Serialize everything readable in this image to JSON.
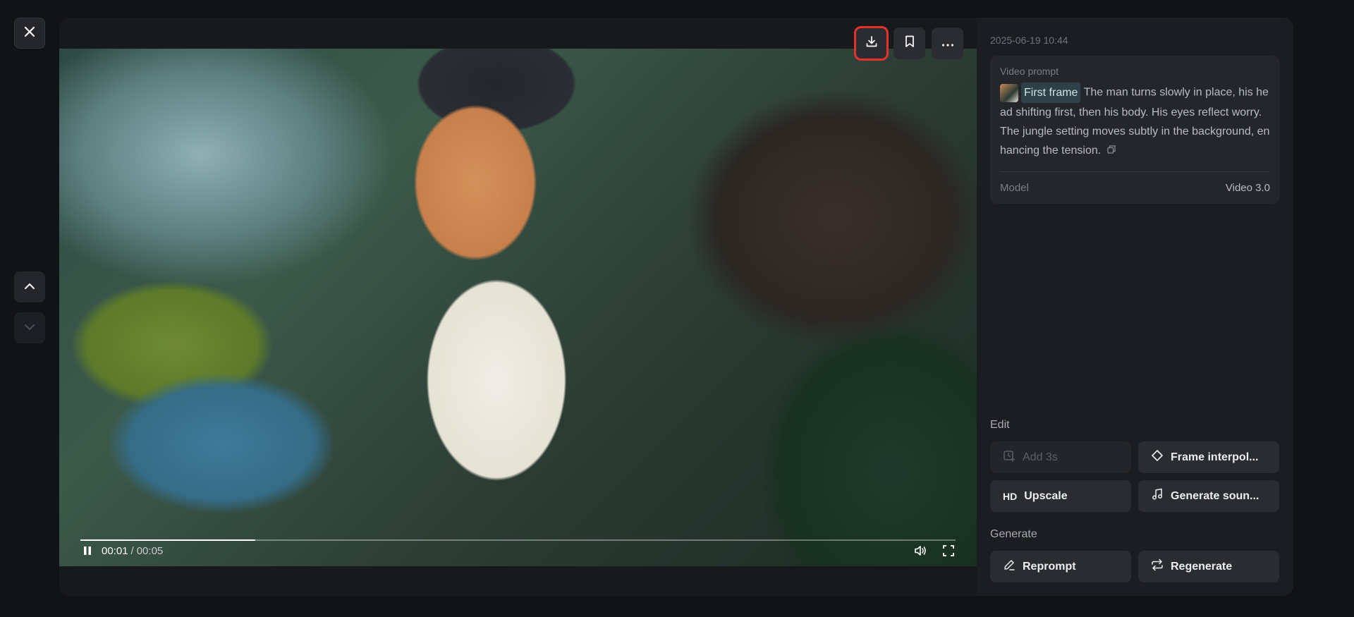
{
  "video": {
    "time_current": "00:01",
    "time_separator": "/",
    "time_total": "00:05",
    "progress": 0.2
  },
  "sidebar": {
    "timestamp": "2025-06-19 10:44",
    "prompt_title": "Video prompt",
    "frame_label": "First frame",
    "prompt_text": "The man turns slowly in place, his head shifting first, then his body. His eyes reflect worry. The jungle setting moves subtly in the background, enhancing the tension.",
    "model_label": "Model",
    "model_value": "Video 3.0"
  },
  "edit": {
    "label": "Edit",
    "add_3s": "Add 3s",
    "frame_interpolation": "Frame interpol...",
    "upscale_icon_text": "HD",
    "upscale": "Upscale",
    "generate_sound": "Generate soun..."
  },
  "generate": {
    "label": "Generate",
    "reprompt": "Reprompt",
    "regenerate": "Regenerate"
  },
  "icons": {
    "close": "close-icon",
    "up": "chevron-up-icon",
    "down": "chevron-down-icon",
    "download": "download-icon",
    "bookmark": "bookmark-icon",
    "more": "more-icon"
  },
  "colors": {
    "highlight": "#e4322b",
    "background": "#121317"
  }
}
